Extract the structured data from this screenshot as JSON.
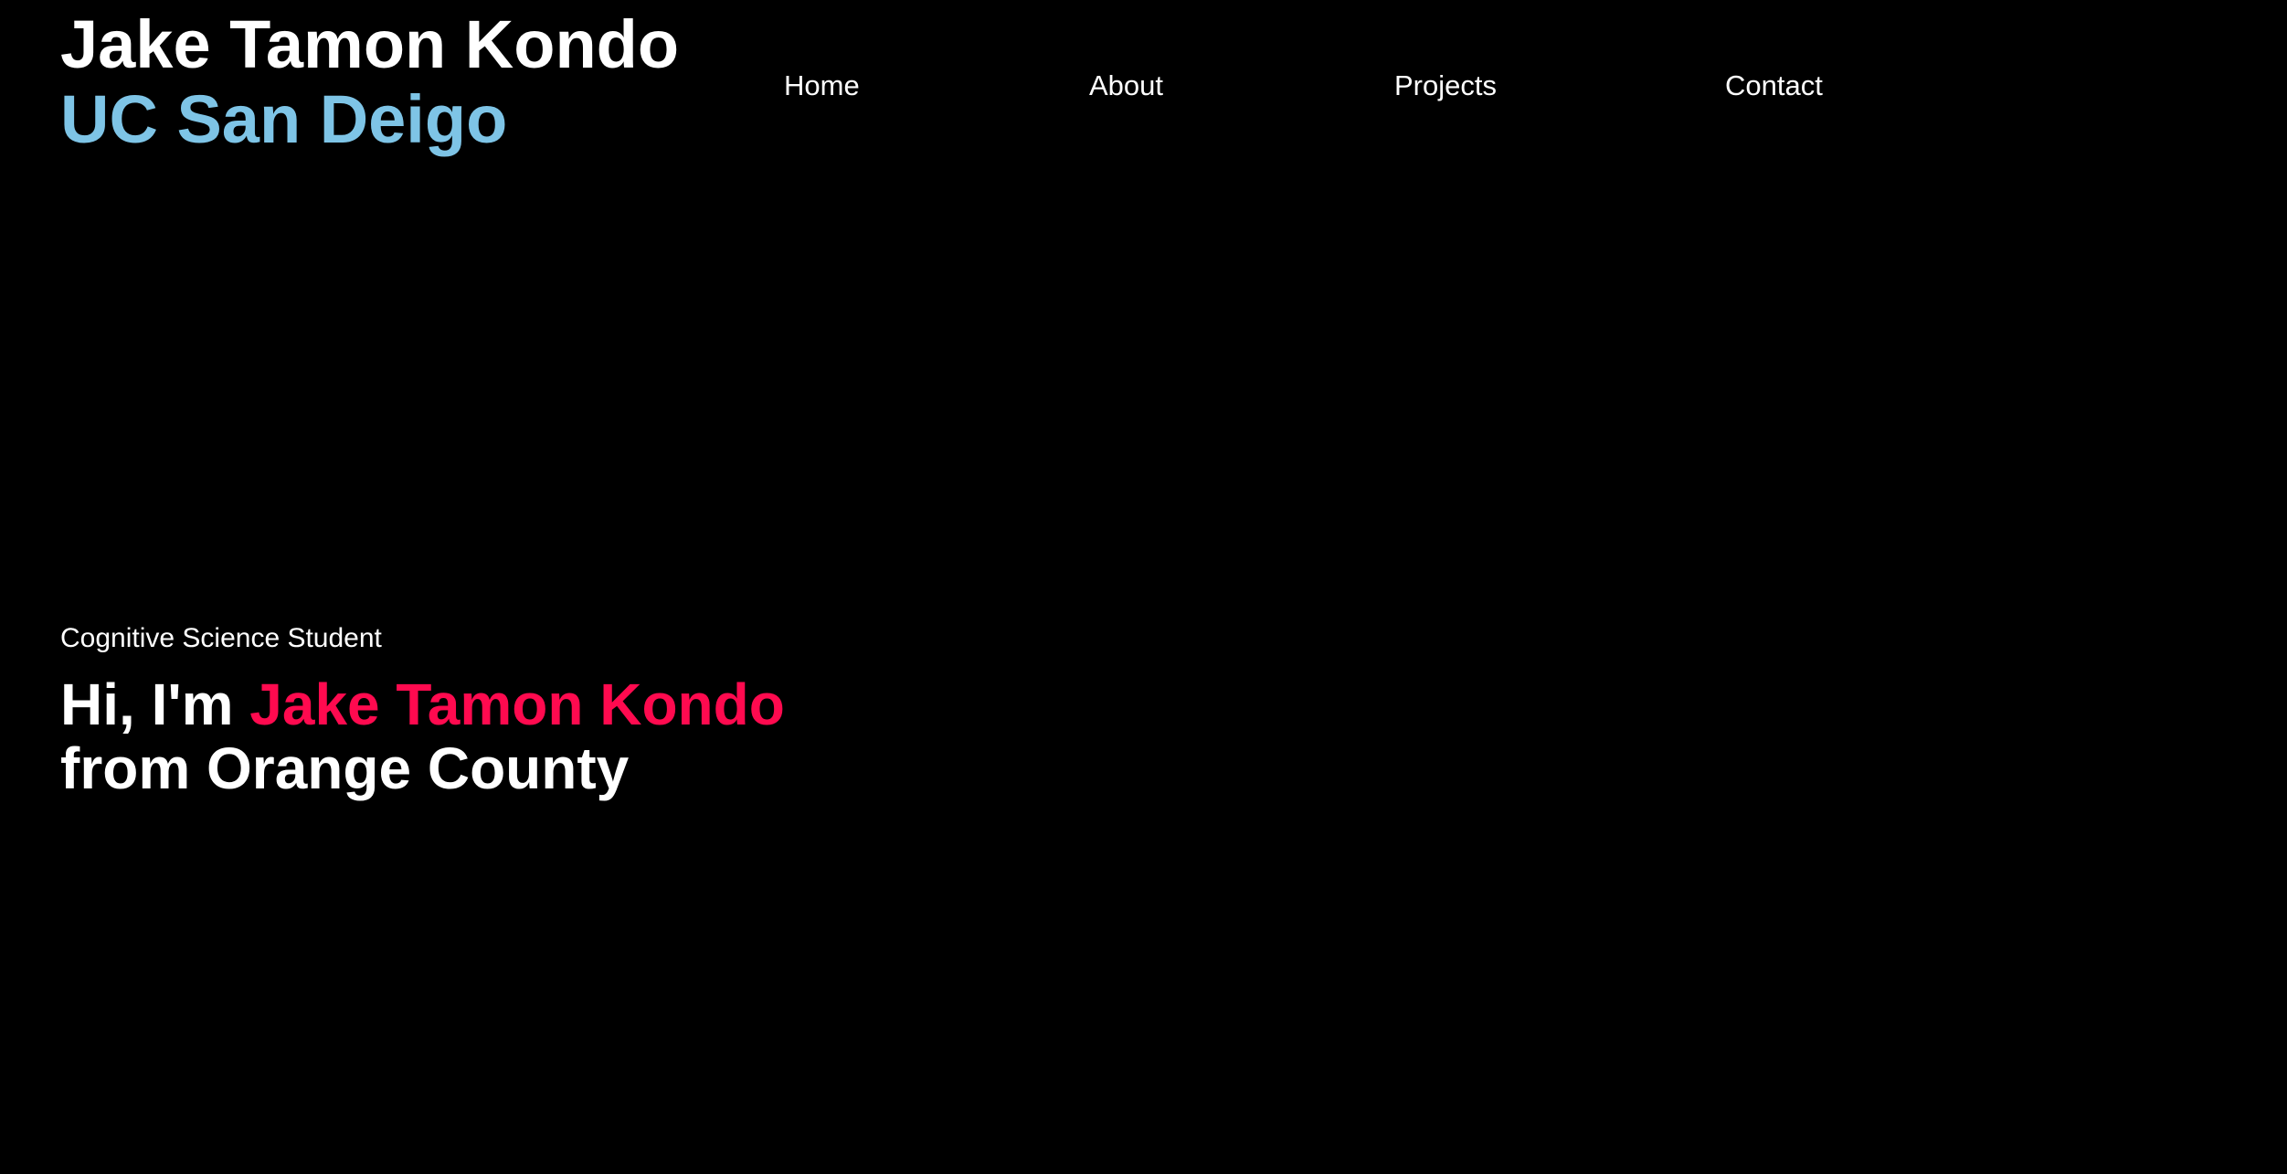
{
  "header": {
    "name": "Jake Tamon Kondo",
    "school": "UC San Deigo"
  },
  "nav": {
    "items": [
      {
        "label": "Home"
      },
      {
        "label": "About"
      },
      {
        "label": "Projects"
      },
      {
        "label": "Contact"
      }
    ]
  },
  "hero": {
    "role": "Cognitive Science Student",
    "greeting_prefix": "Hi, I'm",
    "highlight_name": "Jake Tamon Kondo",
    "line2": "from Orange County"
  },
  "colors": {
    "background": "#000000",
    "text": "#ffffff",
    "school_accent": "#7ec4e6",
    "name_highlight": "#ff0a4f"
  }
}
